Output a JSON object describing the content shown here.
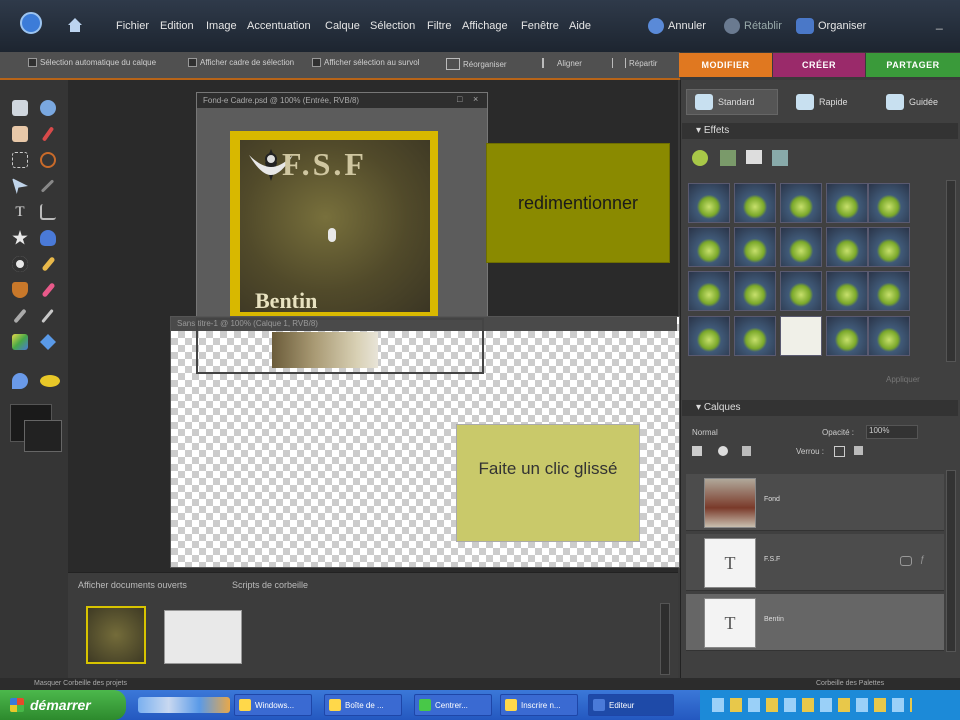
{
  "menubar": {
    "items": [
      "Fichier",
      "Edition",
      "Image",
      "Accentuation",
      "Calque",
      "Sélection",
      "Filtre",
      "Affichage",
      "Fenêtre",
      "Aide"
    ],
    "undo": "Annuler",
    "redo": "Rétablir",
    "organizer": "Organiser"
  },
  "options": {
    "auto_select": "Sélection automatique du calque",
    "show_bbox": "Afficher cadre de sélection",
    "show_highlight": "Afficher sélection au survol",
    "arrange": "Réorganiser",
    "align": "Aligner",
    "distribute": "Répartir"
  },
  "palette_tabs": [
    {
      "label": "MODIFIER",
      "color": "#e07820"
    },
    {
      "label": "CRÉER",
      "color": "#9a2a6a"
    },
    {
      "label": "PARTAGER",
      "color": "#3a9a3a"
    }
  ],
  "document1": {
    "title": "Fond-e Cadre.psd @ 100% (Entrée, RVB/8)",
    "logo_text": "F.S.F",
    "bottom_text": "Bentin"
  },
  "document2": {
    "title": "Sans titre-1 @ 100% (Calque 1, RVB/8)"
  },
  "callouts": {
    "resize": "redimentionner",
    "drag": "Faite un clic glissé"
  },
  "project_bin": {
    "tab1": "Afficher documents ouverts",
    "tab2": "Scripts de corbeille"
  },
  "right_panel": {
    "buttons": [
      "Standard",
      "Rapide",
      "Guidée"
    ],
    "effects_title": "Effets",
    "apply_label": "Appliquer",
    "layers_title": "Calques",
    "blend_mode": "Normal",
    "opacity_label": "Opacité :",
    "opacity_value": "100%",
    "lock_label": "Verrou :",
    "layers": [
      {
        "name": "Fond",
        "thumb": ""
      },
      {
        "name": "F.S.F",
        "thumb": "T"
      },
      {
        "name": "Bentin",
        "thumb": "T"
      }
    ]
  },
  "statusbar": {
    "left": "Masquer Corbeille des projets",
    "right": "Corbeille des Palettes"
  },
  "taskbar": {
    "start": "démarrer",
    "tasks": [
      "Windows...",
      "Boîte de ...",
      "Centrer...",
      "Inscrire n...",
      "Editeur"
    ]
  }
}
